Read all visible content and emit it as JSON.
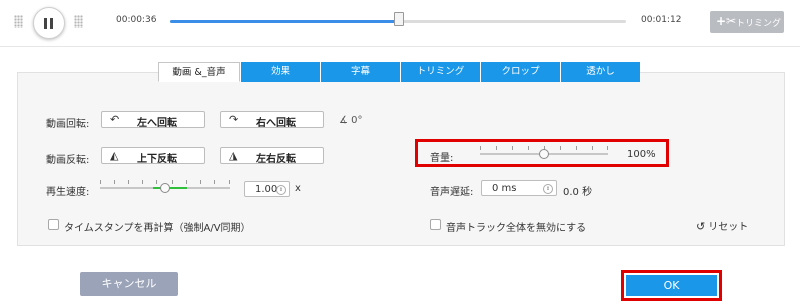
{
  "player": {
    "current_time": "00:00:36",
    "total_time": "00:01:12",
    "progress": 0.5,
    "trim_button_label": "トリミング"
  },
  "tabs": [
    {
      "label": "動画 &_音声",
      "active": true
    },
    {
      "label": "効果",
      "active": false
    },
    {
      "label": "字幕",
      "active": false
    },
    {
      "label": "トリミング",
      "active": false
    },
    {
      "label": "クロップ",
      "active": false
    },
    {
      "label": "透かし",
      "active": false
    }
  ],
  "rotate": {
    "label": "動画回転:",
    "left_button": "左へ回転",
    "right_button": "右へ回転",
    "angle": "0°"
  },
  "flip": {
    "label": "動画反転:",
    "vertical_button": "上下反転",
    "horizontal_button": "左右反転"
  },
  "volume": {
    "label": "音量:",
    "value_text": "100%",
    "level": 0.5
  },
  "speed": {
    "label": "再生速度:",
    "value": "1.00",
    "unit": "x",
    "level": 0.5
  },
  "audio_delay": {
    "label": "音声遅延:",
    "value": "0 ms",
    "readout": "0.0 秒"
  },
  "timestamp_checkbox": {
    "label": "タイムスタンプを再計算（強制A/V同期）",
    "checked": false
  },
  "disable_audio_checkbox": {
    "label": "音声トラック全体を無効にする",
    "checked": false
  },
  "reset_label": "リセット",
  "footer": {
    "cancel_label": "キャンセル",
    "ok_label": "OK"
  },
  "colors": {
    "accent": "#1a97e8",
    "highlight": "#e00000",
    "speed_fill": "#2fbf3a",
    "cancel_bg": "#9aa3b8"
  }
}
